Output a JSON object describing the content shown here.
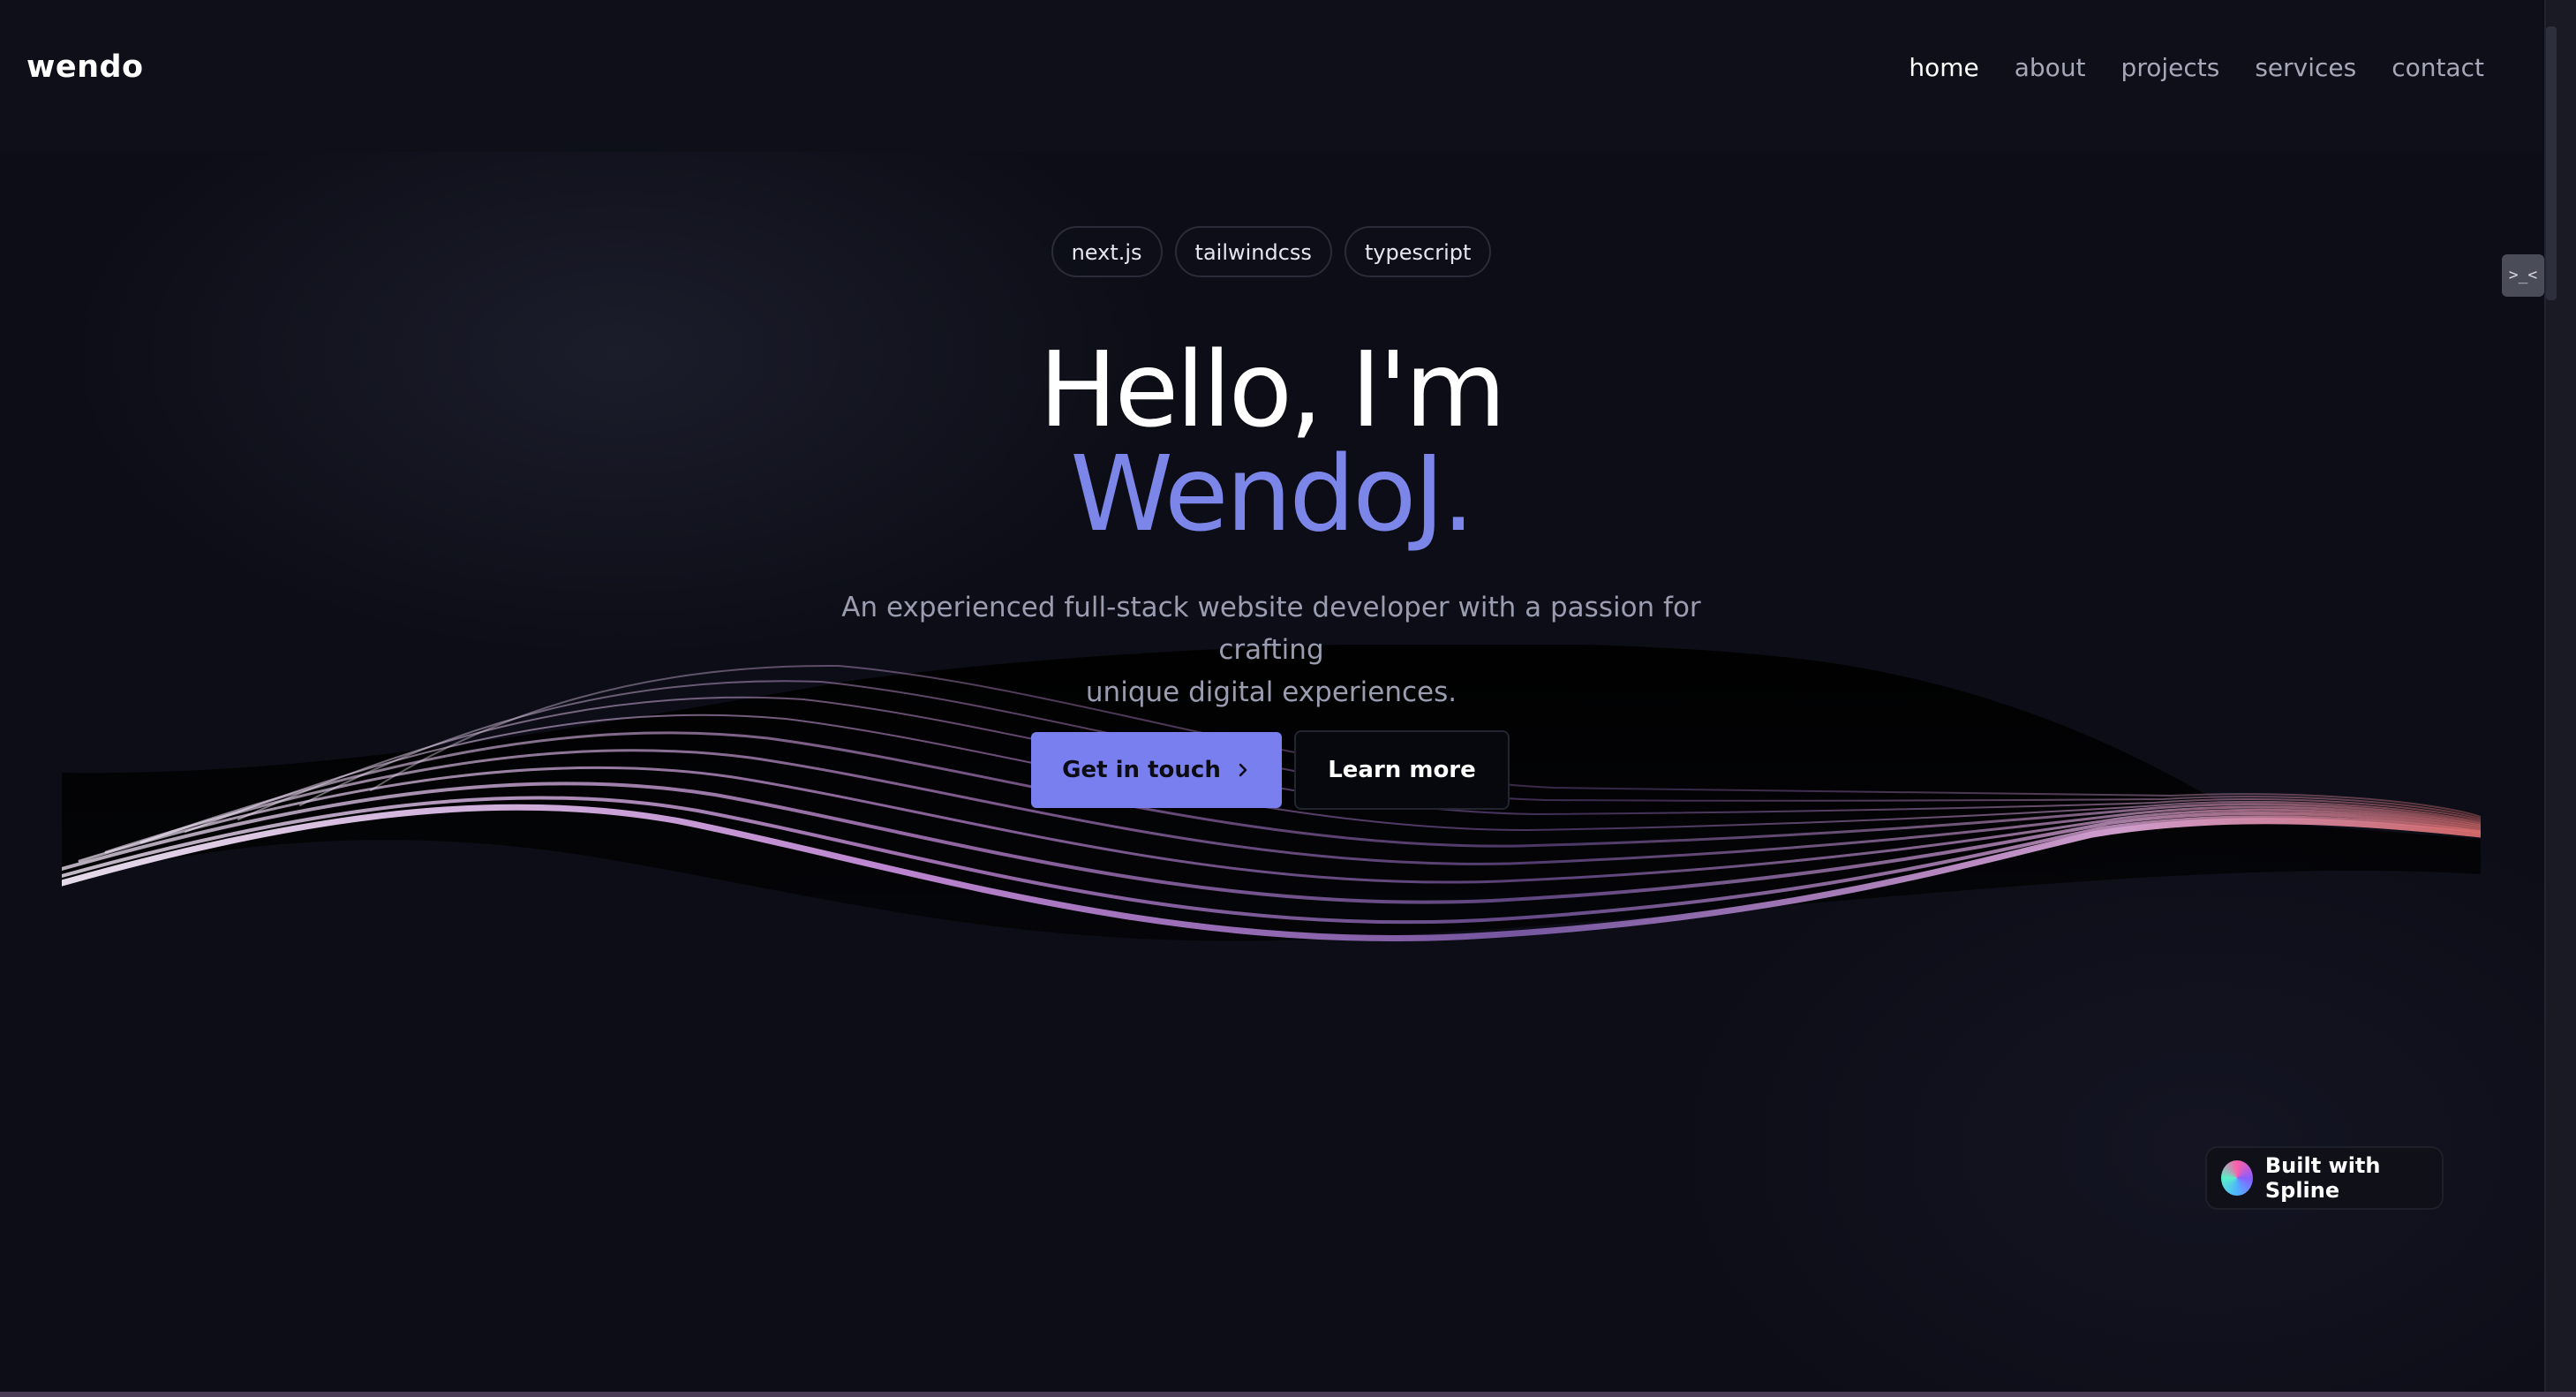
{
  "brand": {
    "logo": "wendo"
  },
  "nav": {
    "items": [
      {
        "label": "home",
        "active": true
      },
      {
        "label": "about",
        "active": false
      },
      {
        "label": "projects",
        "active": false
      },
      {
        "label": "services",
        "active": false
      },
      {
        "label": "contact",
        "active": false
      }
    ]
  },
  "hero": {
    "tags": [
      "next.js",
      "tailwindcss",
      "typescript"
    ],
    "greeting": "Hello, I'm",
    "name": "WendoJ.",
    "subtitle_line1": "An experienced full-stack website developer with a passion for crafting",
    "subtitle_line2": "unique digital experiences.",
    "primary_button": "Get in touch",
    "secondary_button": "Learn more"
  },
  "badge": {
    "label": "Built with Spline"
  },
  "dev_toggle": {
    "label": ">_<"
  },
  "colors": {
    "background": "#0c0d16",
    "accent": "#7b86e8",
    "button_primary": "#7a7ff0",
    "wave_highlight": "#e7b2f0"
  },
  "icons": {
    "chevron": "chevron-right-icon",
    "spline_logo": "spline-logo-icon"
  }
}
